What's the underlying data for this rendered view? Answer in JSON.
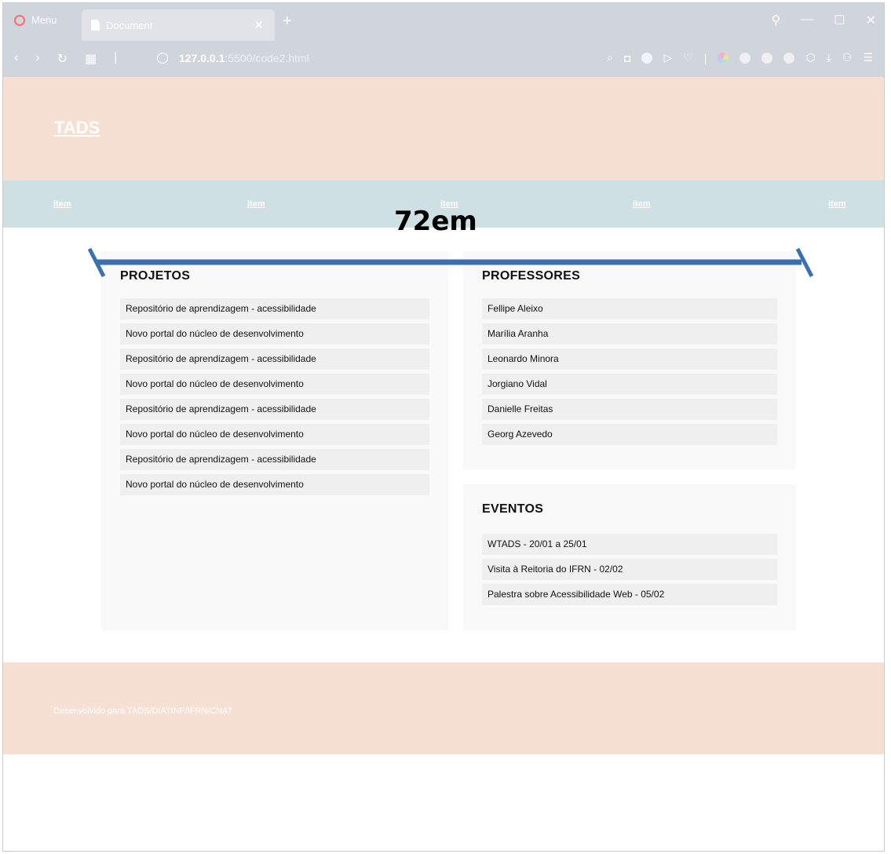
{
  "browser": {
    "menu_label": "Menu",
    "tab_title": "Document",
    "new_tab": "+",
    "url_host": "127.0.0.1",
    "url_path": ":5500/code2.html"
  },
  "site": {
    "title": "TADS",
    "nav": [
      "item",
      "item",
      "item",
      "item",
      "item"
    ]
  },
  "projetos": {
    "heading": "PROJETOS",
    "items": [
      "Repositório de aprendizagem - acessibilidade",
      "Novo portal do núcleo de desenvolvimento",
      "Repositório de aprendizagem - acessibilidade",
      "Novo portal do núcleo de desenvolvimento",
      "Repositório de aprendizagem - acessibilidade",
      "Novo portal do núcleo de desenvolvimento",
      "Repositório de aprendizagem - acessibilidade",
      "Novo portal do núcleo de desenvolvimento"
    ]
  },
  "professores": {
    "heading": "PROFESSORES",
    "items": [
      "Fellipe Aleixo",
      "Marília Aranha",
      "Leonardo Minora",
      "Jorgiano Vidal",
      "Danielle Freitas",
      "Georg Azevedo"
    ]
  },
  "eventos": {
    "heading": "EVENTOS",
    "items": [
      "WTADS - 20/01 a 25/01",
      "Visita à Reitoria do IFRN - 02/02",
      "Palestra sobre Acessibilidade Web - 05/02"
    ]
  },
  "footer": {
    "text": "Desenvolvido para TADS/DIATINF/IFRN/CNAT"
  },
  "annotation": {
    "width_label": "72em",
    "color": "#3a6fb0"
  }
}
